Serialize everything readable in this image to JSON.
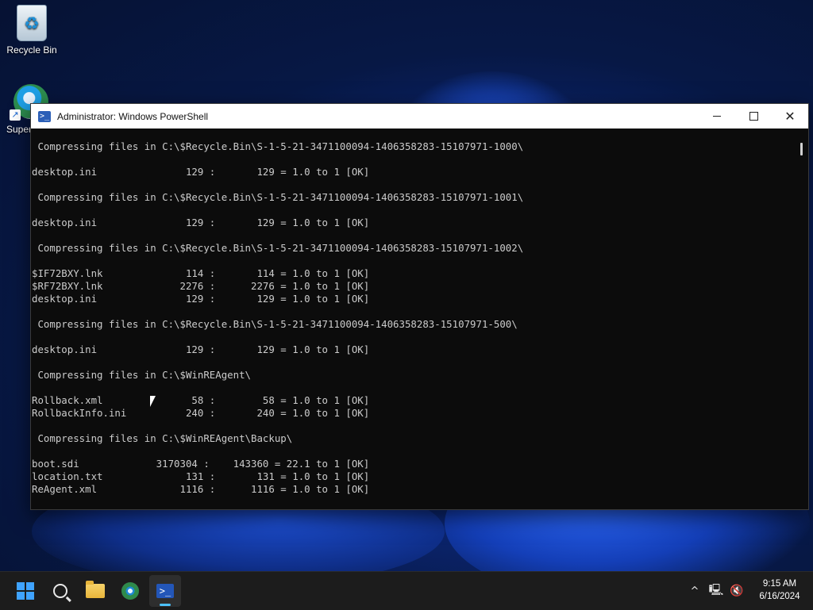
{
  "desktop": {
    "icons": [
      {
        "label": "Recycle Bin",
        "icon": "recycle-bin-icon"
      },
      {
        "label": "Super",
        "icon": "browser-icon"
      }
    ]
  },
  "window": {
    "title": "Administrator: Windows PowerShell",
    "icon": "powershell-icon",
    "controls": {
      "minimize": "minimize-icon",
      "maximize": "maximize-icon",
      "close": "close-icon"
    }
  },
  "console": {
    "lines": [
      " Compressing files in C:\\$Recycle.Bin\\S-1-5-21-3471100094-1406358283-15107971-1000\\",
      "",
      "desktop.ini               129 :       129 = 1.0 to 1 [OK]",
      "",
      " Compressing files in C:\\$Recycle.Bin\\S-1-5-21-3471100094-1406358283-15107971-1001\\",
      "",
      "desktop.ini               129 :       129 = 1.0 to 1 [OK]",
      "",
      " Compressing files in C:\\$Recycle.Bin\\S-1-5-21-3471100094-1406358283-15107971-1002\\",
      "",
      "$IF72BXY.lnk              114 :       114 = 1.0 to 1 [OK]",
      "$RF72BXY.lnk             2276 :      2276 = 1.0 to 1 [OK]",
      "desktop.ini               129 :       129 = 1.0 to 1 [OK]",
      "",
      " Compressing files in C:\\$Recycle.Bin\\S-1-5-21-3471100094-1406358283-15107971-500\\",
      "",
      "desktop.ini               129 :       129 = 1.0 to 1 [OK]",
      "",
      " Compressing files in C:\\$WinREAgent\\",
      "",
      "Rollback.xml               58 :        58 = 1.0 to 1 [OK]",
      "RollbackInfo.ini          240 :       240 = 1.0 to 1 [OK]",
      "",
      " Compressing files in C:\\$WinREAgent\\Backup\\",
      "",
      "boot.sdi             3170304 :    143360 = 22.1 to 1 [OK]",
      "location.txt              131 :       131 = 1.0 to 1 [OK]",
      "ReAgent.xml              1116 :      1116 = 1.0 to 1 [OK]",
      ""
    ]
  },
  "taskbar": {
    "apps": [
      {
        "name": "start-button",
        "icon": "windows-logo-icon"
      },
      {
        "name": "search-button",
        "icon": "search-icon"
      },
      {
        "name": "file-explorer-button",
        "icon": "folder-icon"
      },
      {
        "name": "browser-button",
        "icon": "browser-icon"
      },
      {
        "name": "powershell-button",
        "icon": "powershell-icon",
        "active": true
      }
    ],
    "tray": {
      "overflow": "^",
      "time": "9:15 AM",
      "date": "6/16/2024"
    }
  }
}
